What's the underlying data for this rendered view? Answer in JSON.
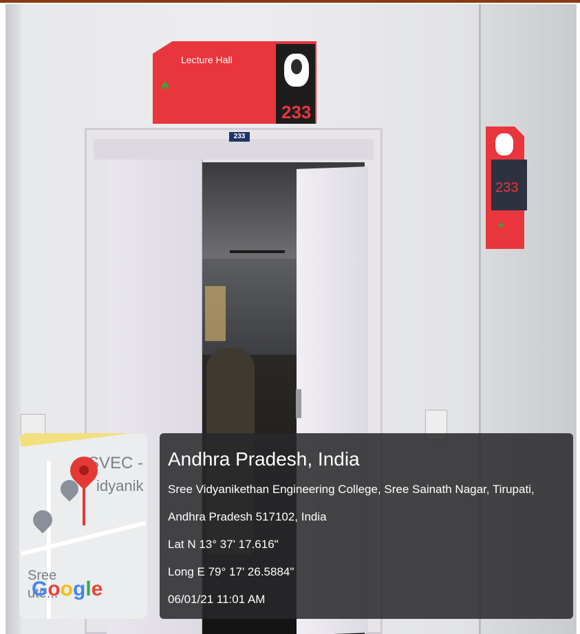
{
  "signs": {
    "main_title": "Lecture Hall",
    "main_number": "233",
    "door_plate_number": "233",
    "side_number": "233"
  },
  "map": {
    "label_line1": "SVEC - S",
    "label_line2": "idyanik",
    "label_line3": "Sree",
    "label_line4": "ute...",
    "google_letters": [
      "G",
      "o",
      "o",
      "g",
      "l",
      "e"
    ]
  },
  "overlay": {
    "title": "Andhra Pradesh, India",
    "address_line1": "Sree Vidyanikethan Engineering College, Sree Sainath Nagar, Tirupati,",
    "address_line2": "Andhra Pradesh 517102, India",
    "latitude": "Lat N 13° 37' 17.616\"",
    "longitude": "Long E 79° 17' 26.5884\"",
    "timestamp": "06/01/21 11:01 AM"
  },
  "colors": {
    "sign_red": "#e8363c",
    "pin_red": "#e53935",
    "overlay_bg": "#28282a"
  }
}
